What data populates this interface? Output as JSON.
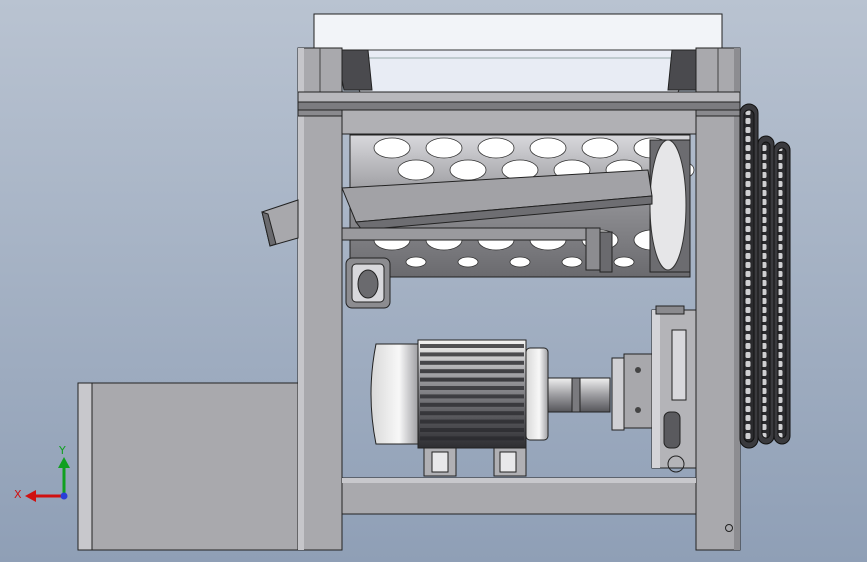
{
  "viewport": {
    "background_top": "#b9c3d1",
    "background_bottom": "#8f9fb6"
  },
  "triad": {
    "x_label": "X",
    "y_label": "Y",
    "x_color": "#d01010",
    "y_color": "#10a020",
    "z_color": "#2a3fd8"
  },
  "model": {
    "frame_color": "#a9a9ad",
    "dark_steel": "#3c3c40",
    "motor_body": "#8a8a8e",
    "hopper_color": "#e8ecf4",
    "parts": [
      "feed-hopper",
      "main-frame",
      "perforated-drum",
      "discharge-chute",
      "side-chute",
      "idler-pulley",
      "electric-motor",
      "reducer-gearbox",
      "chain-sprockets",
      "outlet-box"
    ]
  }
}
